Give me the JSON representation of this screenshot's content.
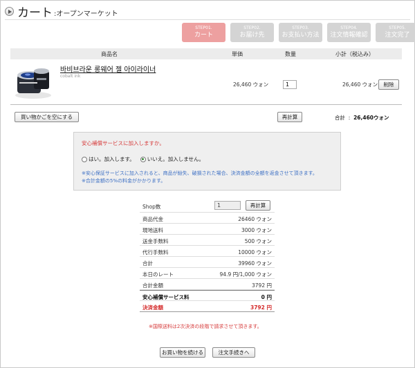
{
  "header": {
    "title": "カート",
    "subtitle": ":オープンマーケット"
  },
  "steps": [
    {
      "num": "STEP01.",
      "label": "カート",
      "active": true
    },
    {
      "num": "STEP02.",
      "label": "お届け先",
      "active": false
    },
    {
      "num": "STEP03.",
      "label": "お支払い方法",
      "active": false
    },
    {
      "num": "STEP04.",
      "label": "注文情報確認",
      "active": false
    },
    {
      "num": "STEP05.",
      "label": "注文完了",
      "active": false
    }
  ],
  "cart": {
    "columns": {
      "product": "商品名",
      "unit_price": "単価",
      "quantity": "数量",
      "subtotal": "小計（税込み）"
    },
    "item": {
      "name": "바비브라운 롱웨어 젤 아이라이너",
      "brand": "cobalt ink",
      "unit_price": "26,460 ウォン",
      "quantity": "1",
      "subtotal": "26,460 ウォン",
      "delete_label": "削除"
    },
    "clear_label": "買い物かごを空にする",
    "recalc_label": "再計算",
    "total_label": "合計",
    "total_value": "26,460ウォン"
  },
  "insurance": {
    "question": "安心補償サービスに加入しますか。",
    "option_yes": "はい。加入します。",
    "option_no": "いいえ。加入しません。",
    "selected": "no",
    "note1": "※安心保証サービスに加入されると、商品が紛失、破損された場合、決済金額の全額を返金させて頂きます。",
    "note2": "※合計金額の5%の料金がかかります。"
  },
  "summary": {
    "shop_label": "Shop数",
    "shop_value": "1",
    "recalc_label": "再計算",
    "rows": [
      {
        "label": "商品代金",
        "value": "26460 ウォン"
      },
      {
        "label": "現地送料",
        "value": "3000 ウォン"
      },
      {
        "label": "送金手数料",
        "value": "500 ウォン"
      },
      {
        "label": "代行手数料",
        "value": "10000 ウォン"
      },
      {
        "label": "合計",
        "value": "39960 ウォン"
      },
      {
        "label": "本日のレート",
        "value": "94.9 円/1,000 ウォン"
      },
      {
        "label": "合計金額",
        "value": "3792 円"
      }
    ],
    "insurance_label": "安心補償サービス料",
    "insurance_value": "0 円",
    "payment_label": "決済金額",
    "payment_value": "3792 円"
  },
  "intl_note": "※国際送料は2次決済の段階で請求させて頂きます。",
  "buttons": {
    "continue": "お買い物を続ける",
    "checkout": "注文手続きへ"
  },
  "colors": {
    "active_step": "#eda0a0",
    "inactive_step": "#d4d4d4",
    "warning_red": "#d63a3a",
    "note_blue": "#3c6fc4"
  }
}
